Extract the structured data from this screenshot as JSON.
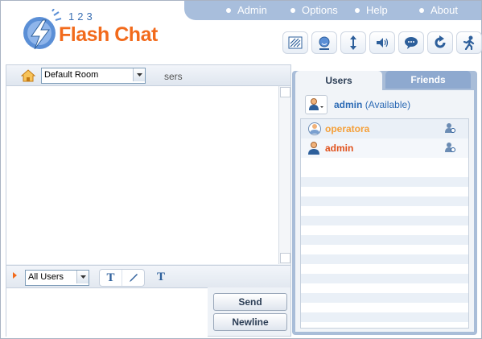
{
  "brand": {
    "numbers": "123",
    "name": "Flash Chat"
  },
  "top_nav": [
    "Admin",
    "Options",
    "Help",
    "About"
  ],
  "toolbar_icons": [
    "skin-icon",
    "smiley-icon",
    "resize-icon",
    "sound-icon",
    "bubble-icon",
    "refresh-icon",
    "logout-icon"
  ],
  "room": {
    "selected": "Default Room",
    "users_fragment": "sers"
  },
  "composer": {
    "recipient": "All Users",
    "bold_label": "T",
    "color_label": "T",
    "send_label": "Send",
    "newline_label": "Newline"
  },
  "users_panel": {
    "tabs": [
      "Users",
      "Friends"
    ],
    "me": {
      "name": "admin",
      "status": "(Available)"
    },
    "users": [
      {
        "name": "operatora",
        "color": "#f5a03a"
      },
      {
        "name": "admin",
        "color": "#e0501a"
      }
    ]
  },
  "colors": {
    "brand_orange": "#f26a1b",
    "nav_blue": "#a8bedc",
    "link_blue": "#2d6bb5"
  }
}
